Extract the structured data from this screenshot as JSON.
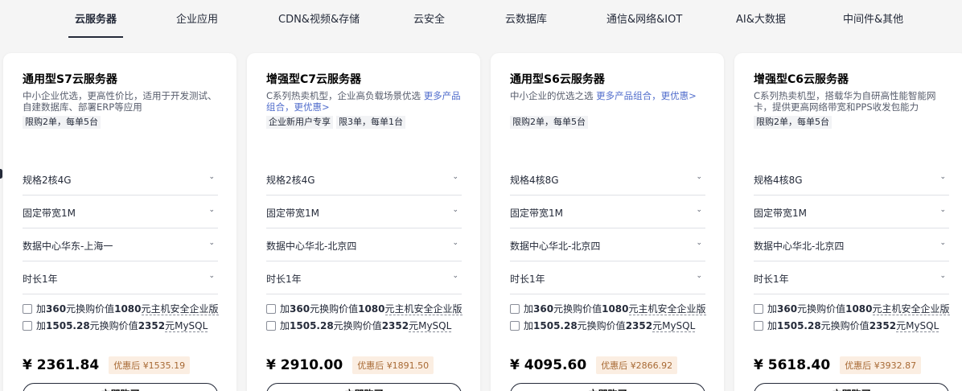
{
  "tabs": [
    {
      "label": "云服务器",
      "active": true
    },
    {
      "label": "企业应用",
      "active": false
    },
    {
      "label": "CDN&视频&存储",
      "active": false
    },
    {
      "label": "云安全",
      "active": false
    },
    {
      "label": "云数据库",
      "active": false
    },
    {
      "label": "通信&网络&IOT",
      "active": false
    },
    {
      "label": "AI&大数据",
      "active": false
    },
    {
      "label": "中间件&其他",
      "active": false
    }
  ],
  "cards": [
    {
      "title": "通用型S7云服务器",
      "desc": "中小企业优选，更高性价比，适用于开发测试、自建数据库、部署ERP等应用",
      "desc_link": "",
      "tags": [
        "限购2单，每单5台"
      ],
      "spec": "规格2核4G",
      "bandwidth": "固定带宽1M",
      "datacenter": "数据中心华东-上海一",
      "duration": "时长1年",
      "addon1": {
        "pre": "加",
        "price": "360",
        "mid": "元换购价值",
        "value": "1080",
        "post": "元主机安全企业版"
      },
      "addon2": {
        "pre": "加",
        "price": "1505.28",
        "mid": "元换购价值",
        "value": "2352",
        "post": "元MySQL"
      },
      "price": "¥ 2361.84",
      "discount_label": "优惠后",
      "discount_price": "¥1535.19",
      "buy_label": "立即购买"
    },
    {
      "title": "增强型C7云服务器",
      "desc": "C系列热卖机型，企业高负载场景优选 ",
      "desc_link": "更多产品组合，更优惠>",
      "tags": [
        "企业新用户专享",
        "限3单，每单1台"
      ],
      "spec": "规格2核4G",
      "bandwidth": "固定带宽1M",
      "datacenter": "数据中心华北-北京四",
      "duration": "时长1年",
      "addon1": {
        "pre": "加",
        "price": "360",
        "mid": "元换购价值",
        "value": "1080",
        "post": "元主机安全企业版"
      },
      "addon2": {
        "pre": "加",
        "price": "1505.28",
        "mid": "元换购价值",
        "value": "2352",
        "post": "元MySQL"
      },
      "price": "¥ 2910.00",
      "discount_label": "优惠后",
      "discount_price": "¥1891.50",
      "buy_label": "立即购买"
    },
    {
      "title": "通用型S6云服务器",
      "desc": "中小企业的优选之选 ",
      "desc_link": "更多产品组合，更优惠>",
      "tags": [
        "限购2单，每单5台"
      ],
      "spec": "规格4核8G",
      "bandwidth": "固定带宽1M",
      "datacenter": "数据中心华北-北京四",
      "duration": "时长1年",
      "addon1": {
        "pre": "加",
        "price": "360",
        "mid": "元换购价值",
        "value": "1080",
        "post": "元主机安全企业版"
      },
      "addon2": {
        "pre": "加",
        "price": "1505.28",
        "mid": "元换购价值",
        "value": "2352",
        "post": "元MySQL"
      },
      "price": "¥ 4095.60",
      "discount_label": "优惠后",
      "discount_price": "¥2866.92",
      "buy_label": "立即购买"
    },
    {
      "title": "增强型C6云服务器",
      "desc": "C系列热卖机型，搭载华为自研高性能智能网卡，提供更高网络带宽和PPS收发包能力",
      "desc_link": "",
      "tags": [
        "限购2单，每单5台"
      ],
      "spec": "规格4核8G",
      "bandwidth": "固定带宽1M",
      "datacenter": "数据中心华北-北京四",
      "duration": "时长1年",
      "addon1": {
        "pre": "加",
        "price": "360",
        "mid": "元换购价值",
        "value": "1080",
        "post": "元主机安全企业版"
      },
      "addon2": {
        "pre": "加",
        "price": "1505.28",
        "mid": "元换购价值",
        "value": "2352",
        "post": "元MySQL"
      },
      "price": "¥ 5618.40",
      "discount_label": "优惠后",
      "discount_price": "¥3932.87",
      "buy_label": "立即购买"
    }
  ],
  "icons": {
    "chevron": "chevron-down-icon",
    "checkbox": "checkbox-unchecked"
  }
}
